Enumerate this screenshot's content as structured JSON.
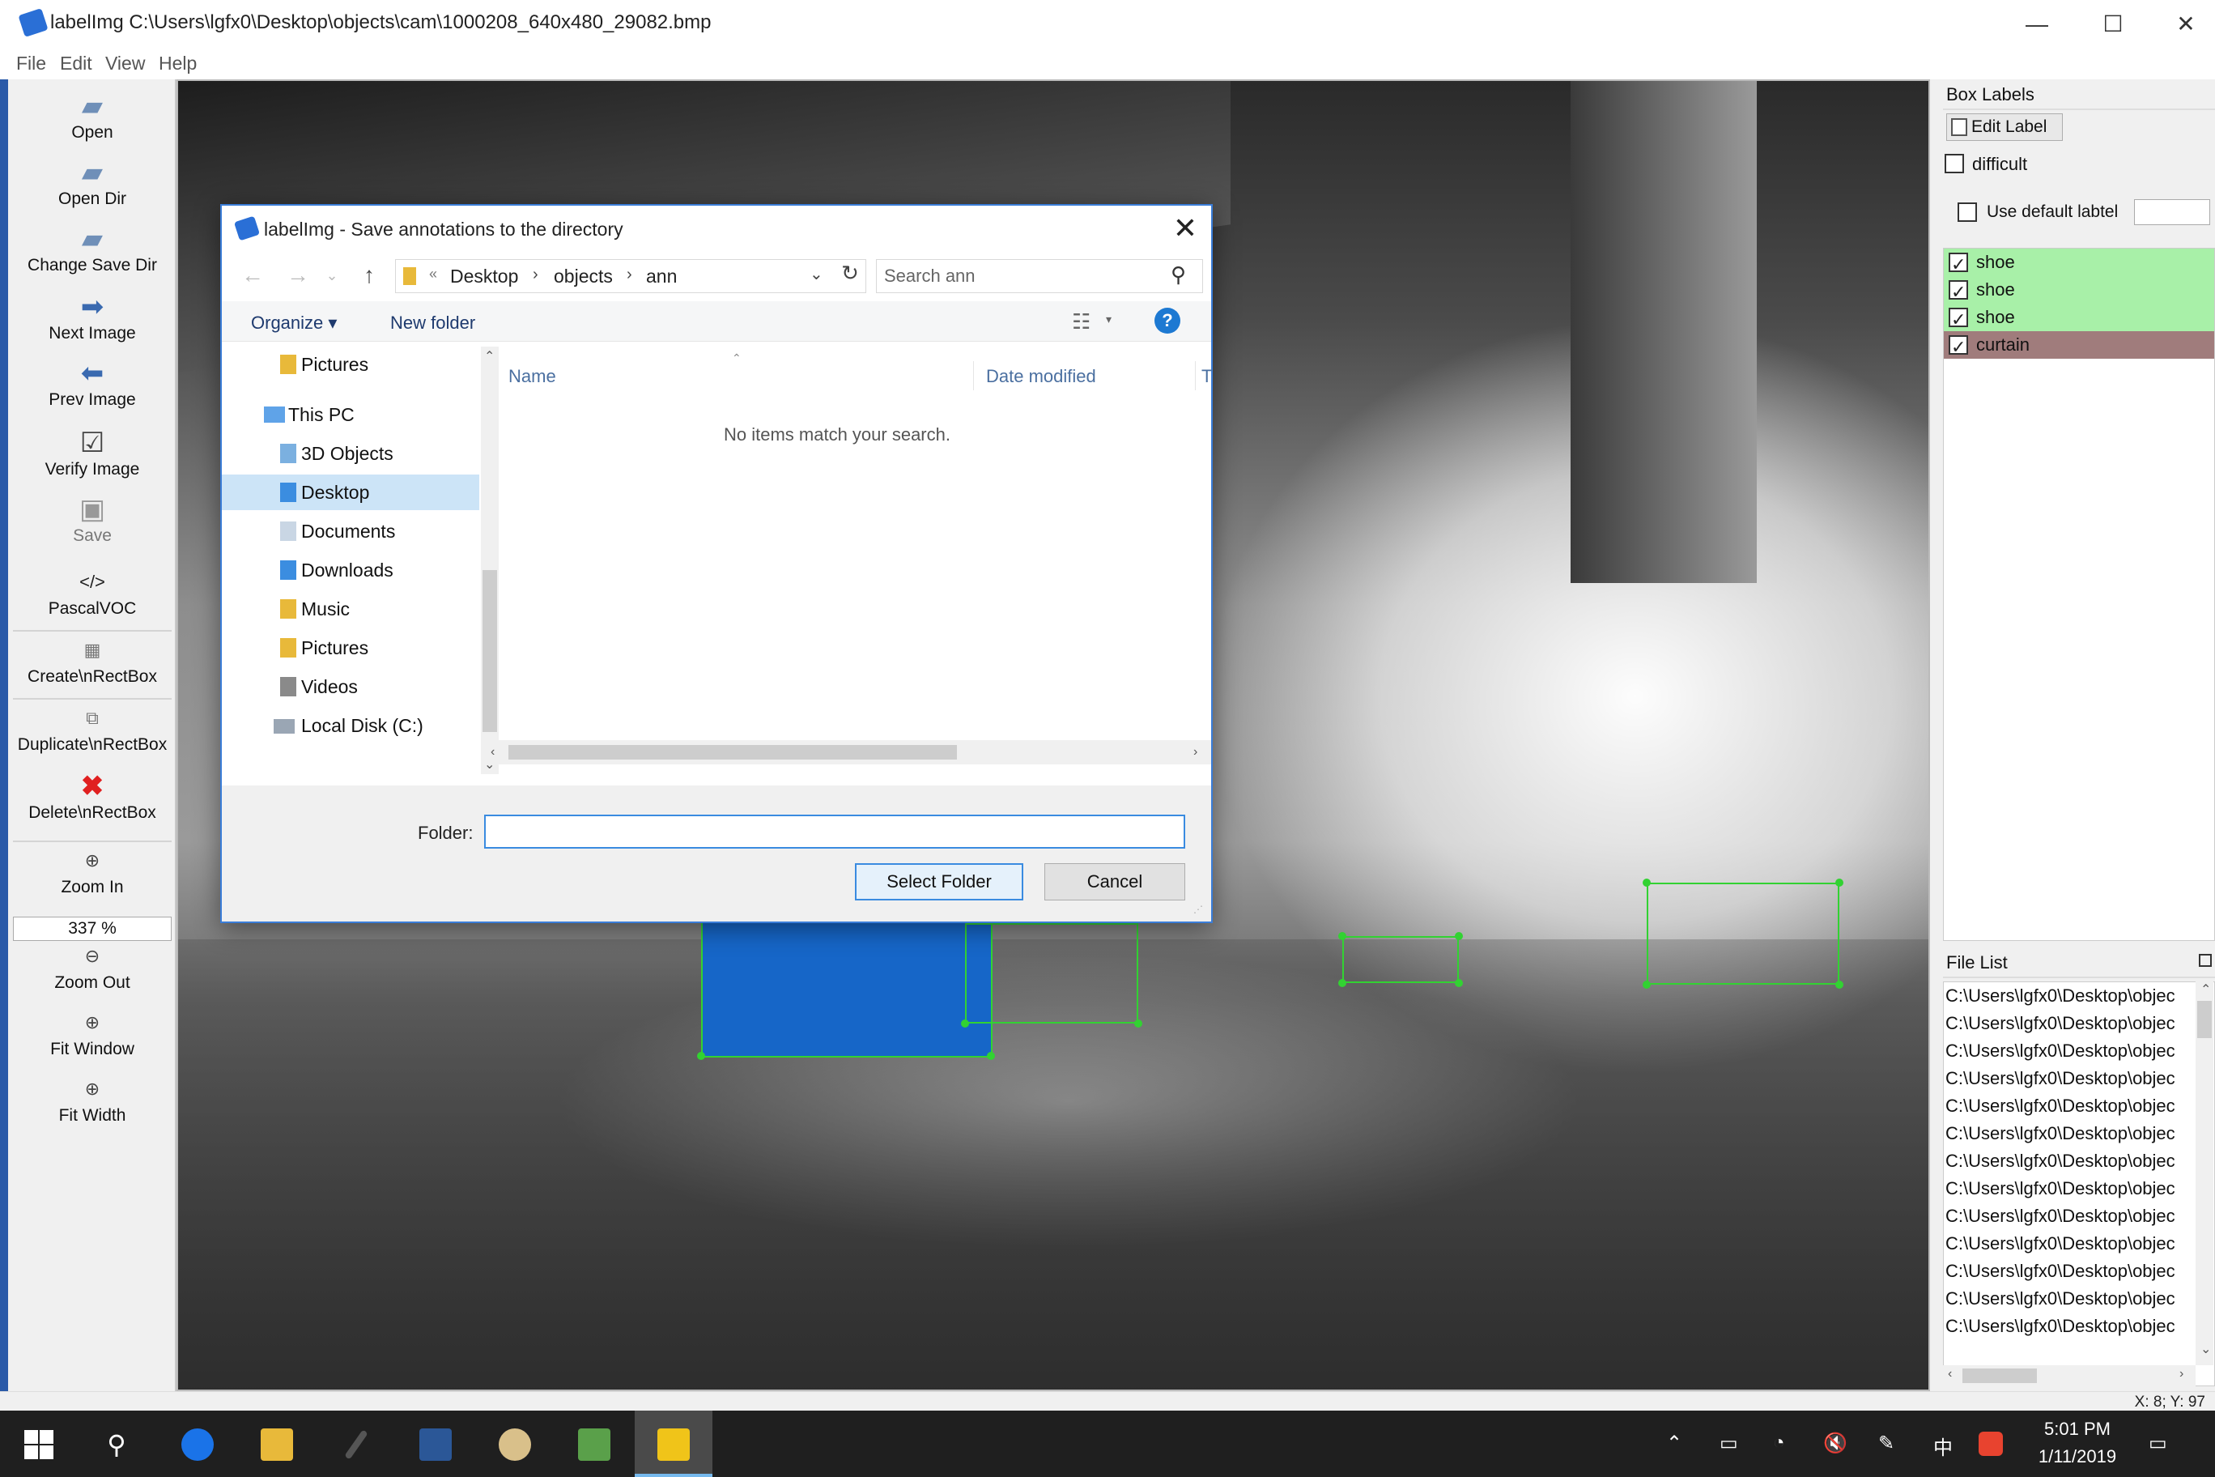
{
  "window": {
    "title": "labelImg C:\\Users\\lgfx0\\Desktop\\objects\\cam\\1000208_640x480_29082.bmp",
    "minimize": "—",
    "maximize": "☐",
    "close": "✕"
  },
  "menu": [
    "File",
    "Edit",
    "View",
    "Help"
  ],
  "toolbar": {
    "open": "Open",
    "open_dir": "Open Dir",
    "change_save_dir": "Change Save Dir",
    "next_image": "Next Image",
    "prev_image": "Prev Image",
    "verify_image": "Verify Image",
    "save": "Save",
    "format_icon": "</>",
    "format": "PascalVOC",
    "create_rect": "Create\\nRectBox",
    "duplicate_rect": "Duplicate\\nRectBox",
    "delete_rect": "Delete\\nRectBox",
    "zoom_in": "Zoom In",
    "zoom_level": "337 %",
    "zoom_out": "Zoom Out",
    "fit_window": "Fit Window",
    "fit_width": "Fit Width"
  },
  "box_labels": {
    "title": "Box Labels",
    "edit_label": "Edit Label",
    "difficult": "difficult",
    "use_default_label": "Use default labtel",
    "default_label_value": "",
    "labels": [
      {
        "name": "shoe",
        "checked": true,
        "color": "#a8f0a8"
      },
      {
        "name": "shoe",
        "checked": true,
        "color": "#a8f0a8"
      },
      {
        "name": "shoe",
        "checked": true,
        "color": "#a8f0a8"
      },
      {
        "name": "curtain",
        "checked": true,
        "color": "#a07c7c"
      }
    ]
  },
  "file_list": {
    "title": "File List",
    "items": [
      "C:\\Users\\lgfx0\\Desktop\\objec",
      "C:\\Users\\lgfx0\\Desktop\\objec",
      "C:\\Users\\lgfx0\\Desktop\\objec",
      "C:\\Users\\lgfx0\\Desktop\\objec",
      "C:\\Users\\lgfx0\\Desktop\\objec",
      "C:\\Users\\lgfx0\\Desktop\\objec",
      "C:\\Users\\lgfx0\\Desktop\\objec",
      "C:\\Users\\lgfx0\\Desktop\\objec",
      "C:\\Users\\lgfx0\\Desktop\\objec",
      "C:\\Users\\lgfx0\\Desktop\\objec",
      "C:\\Users\\lgfx0\\Desktop\\objec",
      "C:\\Users\\lgfx0\\Desktop\\objec",
      "C:\\Users\\lgfx0\\Desktop\\objec"
    ]
  },
  "status": {
    "coords": "X: 8; Y: 97"
  },
  "dialog": {
    "title": "labelImg - Save annotations to the directory",
    "close": "✕",
    "back": "←",
    "forward": "→",
    "recent": "⌄",
    "up": "↑",
    "breadcrumb_more": "«",
    "breadcrumb": [
      "Desktop",
      "objects",
      "ann"
    ],
    "breadcrumb_sep": "›",
    "address_dropdown": "⌄",
    "refresh": "↻",
    "search_placeholder": "Search ann",
    "organize": "Organize ▾",
    "new_folder": "New folder",
    "help": "?",
    "nav_items": [
      {
        "label": "Pictures",
        "type": "folder",
        "color": "#e8b93a"
      },
      {
        "label": "This PC",
        "type": "pc",
        "color": "#5fa3e8"
      },
      {
        "label": "3D Objects",
        "type": "folder",
        "color": "#7bb0e0"
      },
      {
        "label": "Desktop",
        "type": "folder",
        "color": "#3b8de0",
        "selected": true
      },
      {
        "label": "Documents",
        "type": "folder",
        "color": "#c9d6e4"
      },
      {
        "label": "Downloads",
        "type": "folder",
        "color": "#3b8de0"
      },
      {
        "label": "Music",
        "type": "folder",
        "color": "#e8b93a"
      },
      {
        "label": "Pictures",
        "type": "folder",
        "color": "#e8b93a"
      },
      {
        "label": "Videos",
        "type": "folder",
        "color": "#8a8a8a"
      },
      {
        "label": "Local Disk (C:)",
        "type": "drive",
        "color": "#9aa6b4"
      }
    ],
    "columns": {
      "name": "Name",
      "date_modified": "Date modified",
      "type": "T"
    },
    "empty_message": "No items match your search.",
    "folder_label": "Folder:",
    "folder_value": "",
    "select_folder": "Select Folder",
    "cancel": "Cancel"
  },
  "taskbar": {
    "time": "5:01 PM",
    "date": "1/11/2019",
    "tray_icons": [
      "chevron-up-icon",
      "battery-icon",
      "network-icon",
      "mute-icon",
      "pen-icon",
      "ime-icon",
      "sogou-icon",
      "notification-icon"
    ],
    "ime": "中"
  }
}
